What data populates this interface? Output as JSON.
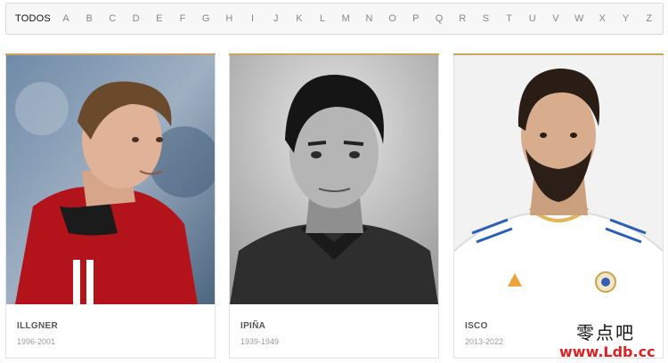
{
  "alphabet": {
    "todos_label": "TODOS",
    "letters": [
      "A",
      "B",
      "C",
      "D",
      "E",
      "F",
      "G",
      "H",
      "I",
      "J",
      "K",
      "L",
      "M",
      "N",
      "O",
      "P",
      "Q",
      "R",
      "S",
      "T",
      "U",
      "V",
      "W",
      "X",
      "Y",
      "Z"
    ]
  },
  "players": [
    {
      "name": "ILLGNER",
      "years": "1996-2001"
    },
    {
      "name": "IPIÑA",
      "years": "1939-1949"
    },
    {
      "name": "ISCO",
      "years": "2013-2022"
    }
  ],
  "watermark": {
    "text_cn": "零点吧",
    "url": "www.Ldb.cc"
  },
  "colors": {
    "card_accent": "#c9a765",
    "watermark_url": "#e02020"
  }
}
